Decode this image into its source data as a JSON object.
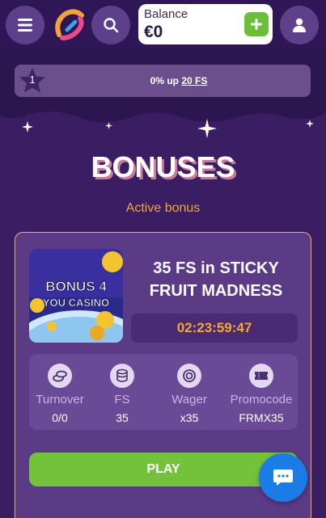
{
  "header": {
    "balance_label": "Balance",
    "balance_value": "€0"
  },
  "level": {
    "number": "1",
    "progress_text": "0% up ",
    "progress_link": "20 FS"
  },
  "hero": {
    "title": "BONUSES",
    "subtitle": "Active bonus"
  },
  "bonus": {
    "image_line1": "BONUS 4",
    "image_line2": "YOU CASINO",
    "title_line1": "35 FS in STICKY",
    "title_line2": "FRUIT MADNESS",
    "timer": "02:23:59:47",
    "stats": [
      {
        "label": "Turnover",
        "value": "0/0",
        "icon": "coins-icon"
      },
      {
        "label": "FS",
        "value": "35",
        "icon": "coin-stack-icon"
      },
      {
        "label": "Wager",
        "value": "x35",
        "icon": "wager-icon"
      },
      {
        "label": "Promocode",
        "value": "FRMX35",
        "icon": "ticket-icon"
      }
    ],
    "play_label": "PLAY"
  },
  "colors": {
    "accent": "#f0a73a",
    "play": "#74c23c",
    "chat": "#1b7ce6",
    "background": "#2c1650"
  }
}
